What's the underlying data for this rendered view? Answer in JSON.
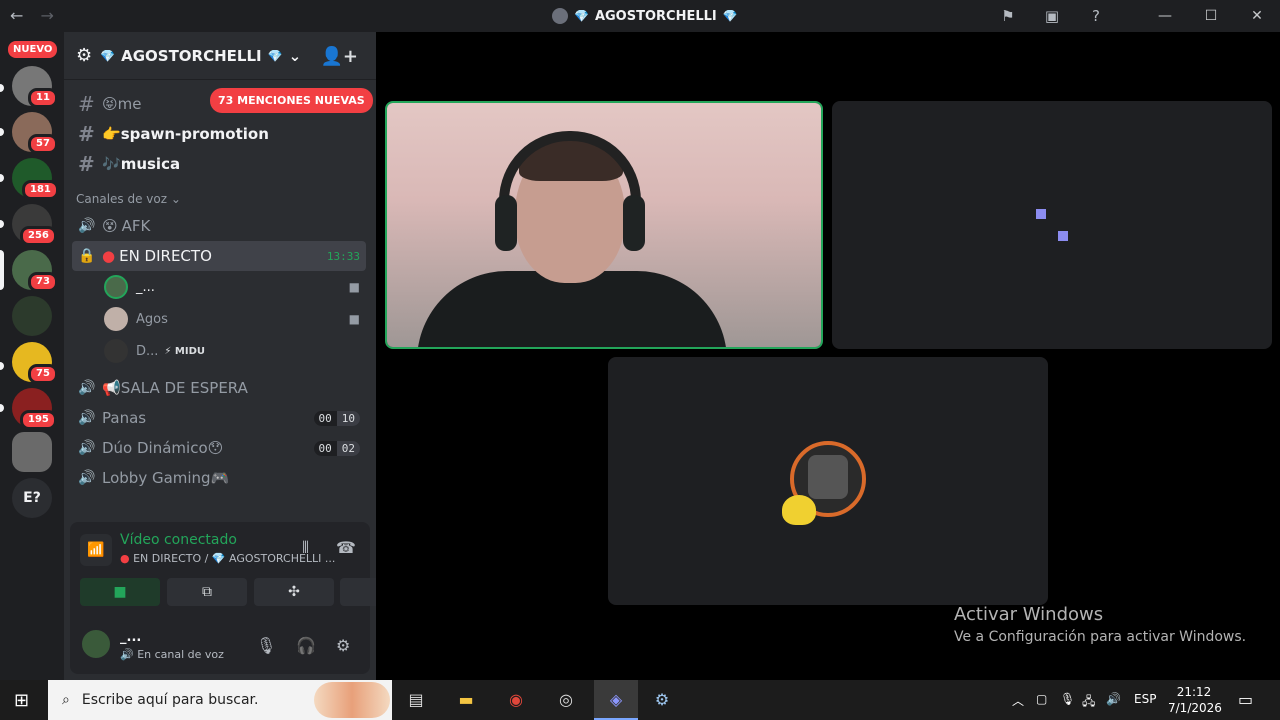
{
  "titlebar": {
    "back": "←",
    "forward": "→",
    "title": "AGOSTORCHELLI",
    "gem_left": "💎",
    "gem_right": "💎",
    "icons": [
      "inbox-flag-icon",
      "inbox-icon",
      "help-icon"
    ],
    "window_controls": [
      "—",
      "☐",
      "✕"
    ]
  },
  "server_rail": {
    "new_label": "NUEVO",
    "badges": [
      "11",
      "57",
      "181",
      "256",
      "73",
      "75",
      "195"
    ],
    "explore_label": "E?"
  },
  "guild": {
    "name": "AGOSTORCHELLI",
    "gem": "💎",
    "chevron": "⌄",
    "mentions_pill": "73 MENCIONES NUEVAS"
  },
  "text_channels": [
    {
      "name": "me",
      "emoji": "😝"
    },
    {
      "name": "spawn-promotion",
      "emoji": "👉"
    },
    {
      "name": "musica",
      "emoji": "🎶"
    }
  ],
  "voice_category": "Canales de voz",
  "voice_channels": {
    "afk": {
      "name": "AFK",
      "emoji": "😵"
    },
    "live": {
      "name": "EN DIRECTO",
      "timer": "13:33"
    },
    "members": [
      {
        "name": "_..."
      },
      {
        "name": "Agos"
      },
      {
        "name": "D...",
        "tag": "⚡ MIDU"
      }
    ],
    "waiting": {
      "name": "SALA DE ESPERA",
      "emoji": "📢"
    },
    "panas": {
      "name": "Panas",
      "count": "00",
      "limit": "10"
    },
    "duo": {
      "name": "Dúo Dinámico",
      "emoji": "😯",
      "count": "00",
      "limit": "02"
    },
    "lobby": {
      "name": "Lobby Gaming",
      "emoji": "🎮"
    }
  },
  "voice_panel": {
    "title": "Vídeo conectado",
    "subtitle": "EN DIRECTO / 💎 AGOSTORCHELLI ...",
    "buttons": [
      "camera",
      "screen-share",
      "activities",
      "soundboard"
    ]
  },
  "user": {
    "name": "_...",
    "status": "En canal de voz"
  },
  "watermark": {
    "line1": "Activar Windows",
    "line2": "Ve a Configuración para activar Windows."
  },
  "taskbar": {
    "search_placeholder": "Escribe aquí para buscar.",
    "lang": "ESP",
    "time": "21:12",
    "date": "7/1/2026"
  },
  "colors": {
    "accent_green": "#23a55a",
    "alert_red": "#f23f43",
    "blurple": "#5865f2"
  }
}
